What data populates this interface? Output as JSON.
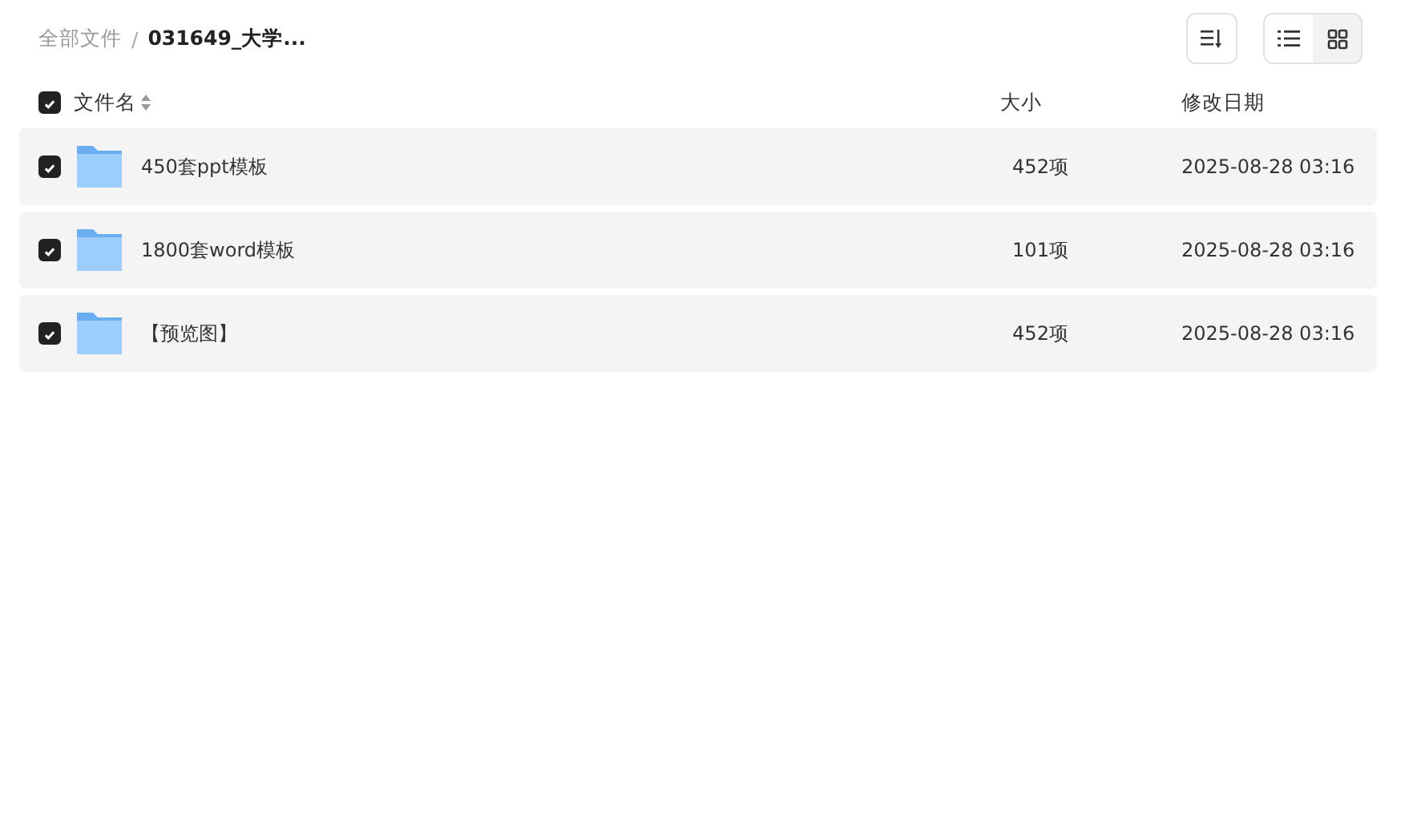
{
  "breadcrumb": [
    {
      "label": "全部文件",
      "current": false
    },
    {
      "label": "031649_大学...",
      "current": true
    }
  ],
  "separator": "/",
  "view_modes": [
    {
      "kind": "list",
      "selected": true
    },
    {
      "kind": "grid",
      "selected": false
    }
  ],
  "header": {
    "checked": true,
    "name": "文件名",
    "size": "大小",
    "date": "修改日期"
  },
  "rows": [
    {
      "checked": true,
      "name": "450套ppt模板",
      "size": "452项",
      "date": "2025-08-28 03:16"
    },
    {
      "checked": true,
      "name": "1800套word模板",
      "size": "101项",
      "date": "2025-08-28 03:16"
    },
    {
      "checked": true,
      "name": "【预览图】",
      "size": "452项",
      "date": "2025-08-28 03:16"
    }
  ]
}
